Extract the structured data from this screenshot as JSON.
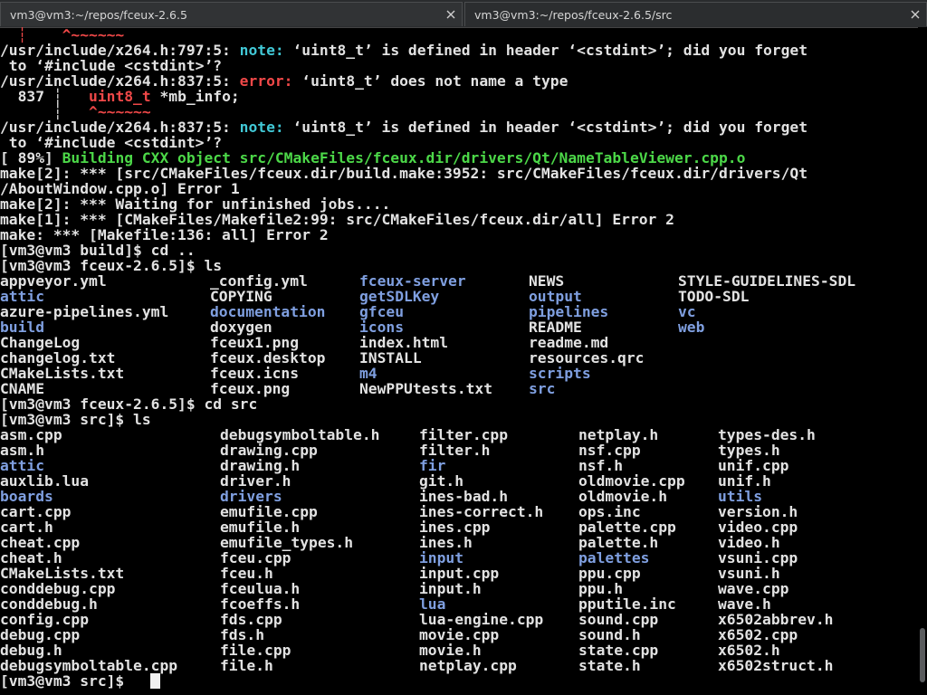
{
  "tabs": [
    {
      "title": "vm3@vm3:~/repos/fceux-2.6.5",
      "close_icon": "close-icon"
    },
    {
      "title": "vm3@vm3:~/repos/fceux-2.6.5/src",
      "close_icon": "close-icon"
    }
  ],
  "colors": {
    "background": "#000000",
    "text": "#e2e2e2",
    "directory": "#7f9fe0",
    "note": "#41c8d6",
    "error": "#f04848",
    "build_progress": "#4cd848"
  },
  "terminal": {
    "lines": [
      {
        "segs": [
          {
            "t": "  ┆    ^~~~~~~",
            "c": "r"
          }
        ]
      },
      {
        "segs": [
          {
            "t": "/usr/include/x264.h:797:5: "
          },
          {
            "t": "note:",
            "c": "n"
          },
          {
            "t": " ‘uint8_t’ is defined in header ‘<cstdint>’; did you forget"
          }
        ]
      },
      {
        "segs": [
          {
            "t": " to ‘#include <cstdint>’?"
          }
        ]
      },
      {
        "segs": [
          {
            "t": "/usr/include/x264.h:837:5: "
          },
          {
            "t": "error:",
            "c": "r"
          },
          {
            "t": " ‘uint8_t’ does not name a type"
          }
        ]
      },
      {
        "segs": [
          {
            "t": "  837 ┆   "
          },
          {
            "t": "uint8_t",
            "c": "r"
          },
          {
            "t": " *mb_info;"
          }
        ]
      },
      {
        "segs": [
          {
            "t": "      ┆   "
          },
          {
            "t": "^~~~~~~",
            "c": "r"
          }
        ]
      },
      {
        "segs": [
          {
            "t": "/usr/include/x264.h:837:5: "
          },
          {
            "t": "note:",
            "c": "n"
          },
          {
            "t": " ‘uint8_t’ is defined in header ‘<cstdint>’; did you forget"
          }
        ]
      },
      {
        "segs": [
          {
            "t": " to ‘#include <cstdint>’?"
          }
        ]
      },
      {
        "segs": [
          {
            "t": "[ 89%] "
          },
          {
            "t": "Building CXX object src/CMakeFiles/fceux.dir/drivers/Qt/NameTableViewer.cpp.o",
            "c": "g"
          }
        ]
      },
      {
        "segs": [
          {
            "t": "make[2]: *** [src/CMakeFiles/fceux.dir/build.make:3952: src/CMakeFiles/fceux.dir/drivers/Qt"
          }
        ]
      },
      {
        "segs": [
          {
            "t": "/AboutWindow.cpp.o] Error 1"
          }
        ]
      },
      {
        "segs": [
          {
            "t": "make[2]: *** Waiting for unfinished jobs...."
          }
        ]
      },
      {
        "segs": [
          {
            "t": "make[1]: *** [CMakeFiles/Makefile2:99: src/CMakeFiles/fceux.dir/all] Error 2"
          }
        ]
      },
      {
        "segs": [
          {
            "t": "make: *** [Makefile:136: all] Error 2"
          }
        ]
      },
      {
        "segs": [
          {
            "t": "[vm3@vm3 build]$ cd .."
          }
        ]
      },
      {
        "segs": [
          {
            "t": "[vm3@vm3 fceux-2.6.5]$ ls"
          }
        ]
      }
    ],
    "ls_root_rows": [
      [
        {
          "t": "appveyor.yml"
        },
        {
          "t": "_config.yml"
        },
        {
          "t": "fceux-server",
          "c": "d"
        },
        {
          "t": "NEWS"
        },
        {
          "t": "STYLE-GUIDELINES-SDL"
        }
      ],
      [
        {
          "t": "attic",
          "c": "d"
        },
        {
          "t": "COPYING"
        },
        {
          "t": "getSDLKey",
          "c": "d"
        },
        {
          "t": "output",
          "c": "d"
        },
        {
          "t": "TODO-SDL"
        }
      ],
      [
        {
          "t": "azure-pipelines.yml"
        },
        {
          "t": "documentation",
          "c": "d"
        },
        {
          "t": "gfceu",
          "c": "d"
        },
        {
          "t": "pipelines",
          "c": "d"
        },
        {
          "t": "vc",
          "c": "d"
        }
      ],
      [
        {
          "t": "build",
          "c": "d"
        },
        {
          "t": "doxygen"
        },
        {
          "t": "icons",
          "c": "d"
        },
        {
          "t": "README"
        },
        {
          "t": "web",
          "c": "d"
        }
      ],
      [
        {
          "t": "ChangeLog"
        },
        {
          "t": "fceux1.png"
        },
        {
          "t": "index.html"
        },
        {
          "t": "readme.md"
        },
        {
          "t": ""
        }
      ],
      [
        {
          "t": "changelog.txt"
        },
        {
          "t": "fceux.desktop"
        },
        {
          "t": "INSTALL"
        },
        {
          "t": "resources.qrc"
        },
        {
          "t": ""
        }
      ],
      [
        {
          "t": "CMakeLists.txt"
        },
        {
          "t": "fceux.icns"
        },
        {
          "t": "m4",
          "c": "d"
        },
        {
          "t": "scripts",
          "c": "d"
        },
        {
          "t": ""
        }
      ],
      [
        {
          "t": "CNAME"
        },
        {
          "t": "fceux.png"
        },
        {
          "t": "NewPPUtests.txt"
        },
        {
          "t": "src",
          "c": "d"
        },
        {
          "t": ""
        }
      ]
    ],
    "cmd_cd_src": "[vm3@vm3 fceux-2.6.5]$ cd src",
    "cmd_ls_src": "[vm3@vm3 src]$ ls",
    "ls_src_rows": [
      [
        {
          "t": "asm.cpp"
        },
        {
          "t": "debugsymboltable.h"
        },
        {
          "t": "filter.cpp"
        },
        {
          "t": "netplay.h"
        },
        {
          "t": "types-des.h"
        }
      ],
      [
        {
          "t": "asm.h"
        },
        {
          "t": "drawing.cpp"
        },
        {
          "t": "filter.h"
        },
        {
          "t": "nsf.cpp"
        },
        {
          "t": "types.h"
        }
      ],
      [
        {
          "t": "attic",
          "c": "d"
        },
        {
          "t": "drawing.h"
        },
        {
          "t": "fir",
          "c": "d"
        },
        {
          "t": "nsf.h"
        },
        {
          "t": "unif.cpp"
        }
      ],
      [
        {
          "t": "auxlib.lua"
        },
        {
          "t": "driver.h"
        },
        {
          "t": "git.h"
        },
        {
          "t": "oldmovie.cpp"
        },
        {
          "t": "unif.h"
        }
      ],
      [
        {
          "t": "boards",
          "c": "d"
        },
        {
          "t": "drivers",
          "c": "d"
        },
        {
          "t": "ines-bad.h"
        },
        {
          "t": "oldmovie.h"
        },
        {
          "t": "utils",
          "c": "d"
        }
      ],
      [
        {
          "t": "cart.cpp"
        },
        {
          "t": "emufile.cpp"
        },
        {
          "t": "ines-correct.h"
        },
        {
          "t": "ops.inc"
        },
        {
          "t": "version.h"
        }
      ],
      [
        {
          "t": "cart.h"
        },
        {
          "t": "emufile.h"
        },
        {
          "t": "ines.cpp"
        },
        {
          "t": "palette.cpp"
        },
        {
          "t": "video.cpp"
        }
      ],
      [
        {
          "t": "cheat.cpp"
        },
        {
          "t": "emufile_types.h"
        },
        {
          "t": "ines.h"
        },
        {
          "t": "palette.h"
        },
        {
          "t": "video.h"
        }
      ],
      [
        {
          "t": "cheat.h"
        },
        {
          "t": "fceu.cpp"
        },
        {
          "t": "input",
          "c": "d"
        },
        {
          "t": "palettes",
          "c": "d"
        },
        {
          "t": "vsuni.cpp"
        }
      ],
      [
        {
          "t": "CMakeLists.txt"
        },
        {
          "t": "fceu.h"
        },
        {
          "t": "input.cpp"
        },
        {
          "t": "ppu.cpp"
        },
        {
          "t": "vsuni.h"
        }
      ],
      [
        {
          "t": "conddebug.cpp"
        },
        {
          "t": "fceulua.h"
        },
        {
          "t": "input.h"
        },
        {
          "t": "ppu.h"
        },
        {
          "t": "wave.cpp"
        }
      ],
      [
        {
          "t": "conddebug.h"
        },
        {
          "t": "fcoeffs.h"
        },
        {
          "t": "lua",
          "c": "d"
        },
        {
          "t": "pputile.inc"
        },
        {
          "t": "wave.h"
        }
      ],
      [
        {
          "t": "config.cpp"
        },
        {
          "t": "fds.cpp"
        },
        {
          "t": "lua-engine.cpp"
        },
        {
          "t": "sound.cpp"
        },
        {
          "t": "x6502abbrev.h"
        }
      ],
      [
        {
          "t": "debug.cpp"
        },
        {
          "t": "fds.h"
        },
        {
          "t": "movie.cpp"
        },
        {
          "t": "sound.h"
        },
        {
          "t": "x6502.cpp"
        }
      ],
      [
        {
          "t": "debug.h"
        },
        {
          "t": "file.cpp"
        },
        {
          "t": "movie.h"
        },
        {
          "t": "state.cpp"
        },
        {
          "t": "x6502.h"
        }
      ],
      [
        {
          "t": "debugsymboltable.cpp"
        },
        {
          "t": "file.h"
        },
        {
          "t": "netplay.cpp"
        },
        {
          "t": "state.h"
        },
        {
          "t": "x6502struct.h"
        }
      ]
    ],
    "prompt": "[vm3@vm3 src]$ "
  }
}
